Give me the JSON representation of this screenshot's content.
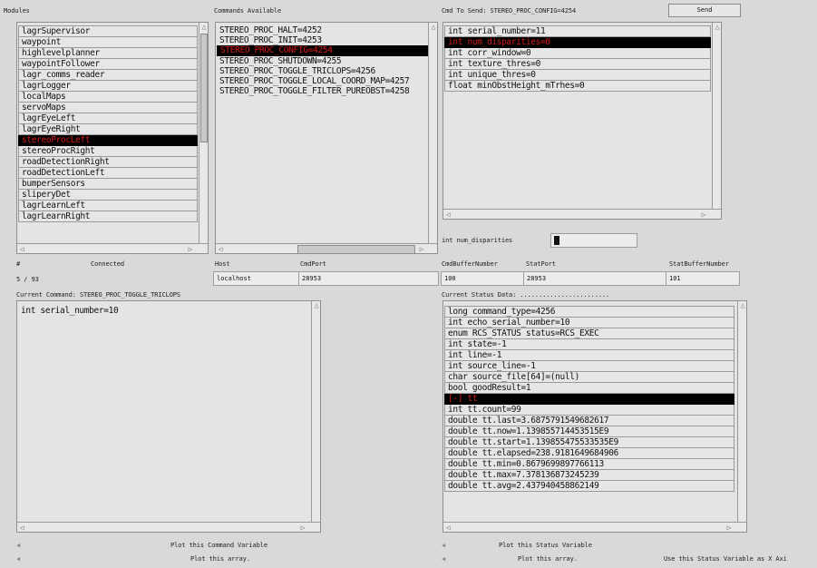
{
  "modules": {
    "header": "Modules",
    "items": [
      "lagrSupervisor",
      "waypoint",
      "highlevelplanner",
      "waypointFollower",
      "lagr_comms_reader",
      "lagrLogger",
      "localMaps",
      "servoMaps",
      "lagrEyeLeft",
      "lagrEyeRight",
      "stereoProcLeft",
      "stereoProcRight",
      "roadDetectionRight",
      "roadDetectionLeft",
      "bumperSensors",
      "sliperyDet",
      "lagrLearnLeft",
      "lagrLearnRight"
    ],
    "selected_index": 10
  },
  "commands": {
    "header": "Commands Available",
    "items": [
      "STEREO_PROC_HALT=4252",
      "STEREO_PROC_INIT=4253",
      "STEREO_PROC_CONFIG=4254",
      "STEREO_PROC_SHUTDOWN=4255",
      "STEREO_PROC_TOGGLE_TRICLOPS=4256",
      "STEREO_PROC_TOGGLE_LOCAL_COORD_MAP=4257",
      "STEREO_PROC_TOGGLE_FILTER_PUREOBST=4258"
    ],
    "selected_index": 2
  },
  "cmd_to_send": {
    "header": "Cmd To Send: STEREO_PROC_CONFIG=4254",
    "send_label": "Send",
    "items": [
      "int serial_number=11",
      "int num_disparities=0",
      "int corr_window=0",
      "int texture_thres=0",
      "int unique_thres=0",
      "float minObstHeight_mTrhes=0"
    ],
    "selected_index": 1,
    "edit_label": "int num_disparities",
    "edit_value": "0"
  },
  "connection": {
    "col_hash": "#",
    "col_connected": "Connected",
    "col_host": "Host",
    "col_cmdport": "CmdPort",
    "col_cmdbuffer": "CmdBufferNumber",
    "col_statport": "StatPort",
    "col_statbuffer": "StatBufferNumber",
    "count": "5 / 93",
    "host": "localhost",
    "cmdport": "28953",
    "cmdbuffer": "100",
    "statport": "28953",
    "statbuffer": "101"
  },
  "current_command": {
    "header": "Current Command: STEREO_PROC_TOGGLE_TRICLOPS",
    "items": [
      "int serial_number=10"
    ],
    "plot_variable_label": "Plot this Command Variable",
    "plot_array_label": "Plot this array."
  },
  "status": {
    "header": "Current Status Data: ........................",
    "items": [
      "long command_type=4256",
      "int echo_serial_number=10",
      "enum RCS_STATUS status=RCS_EXEC",
      "int state=-1",
      "int line=-1",
      "int source_line=-1",
      "char source_file[64]=(null)",
      "bool goodResult=1",
      "[-] tt",
      "int tt.count=99",
      "double tt.last=3.6875791549682617",
      "double tt.now=1.139855714453515E9",
      "double tt.start=1.139855475533535E9",
      "double tt.elapsed=238.9181649684906",
      "double tt.min=0.8679699897766113",
      "double tt.max=7.378136873245239",
      "double tt.avg=2.437940458862149"
    ],
    "selected_index": 8,
    "plot_variable_label": "Plot this Status Variable",
    "plot_array_label": "Plot this array.",
    "use_as_x_label": "Use this Status Variable as X Axi"
  }
}
